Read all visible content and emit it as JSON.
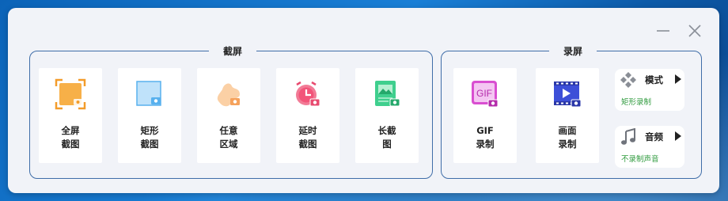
{
  "window": {
    "minimize_icon": "minimize-icon",
    "close_icon": "close-icon"
  },
  "screenshot_group": {
    "title": "截屏",
    "tiles": [
      {
        "line1": "全屏",
        "line2": "截图",
        "icon": "fullscreen-capture-icon"
      },
      {
        "line1": "矩形",
        "line2": "截图",
        "icon": "rectangle-capture-icon"
      },
      {
        "line1": "任意",
        "line2": "区域",
        "icon": "freeform-capture-icon"
      },
      {
        "line1": "延时",
        "line2": "截图",
        "icon": "delayed-capture-icon"
      },
      {
        "line1": "长截",
        "line2": "图",
        "icon": "scrolling-capture-icon"
      }
    ]
  },
  "record_group": {
    "title": "录屏",
    "tiles": [
      {
        "line1": "GIF",
        "line2": "录制",
        "icon": "gif-record-icon",
        "icon_text": "GIF"
      },
      {
        "line1": "画面",
        "line2": "录制",
        "icon": "video-record-icon"
      }
    ],
    "mode": {
      "title": "模式",
      "value": "矩形录制",
      "icon": "mode-diamond-icon"
    },
    "audio": {
      "title": "音频",
      "value": "不录制声音",
      "icon": "music-note-icon"
    }
  },
  "colors": {
    "accent_border": "#3f6da8",
    "status_green": "#2e9a3c",
    "panel_bg": "#f1f3f8"
  }
}
